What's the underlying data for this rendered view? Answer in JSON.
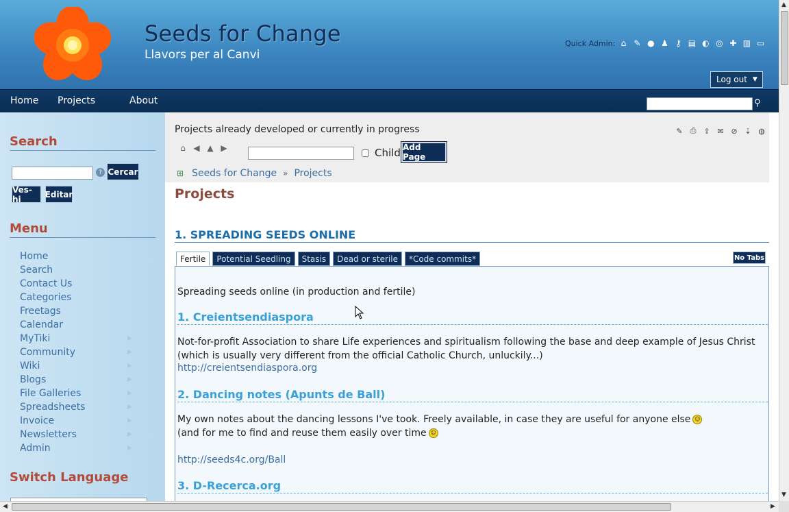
{
  "header": {
    "site_title": "Seeds for Change",
    "site_subtitle": "Llavors per al Canvi",
    "quick_admin_label": "Quick Admin:",
    "quick_admin_icons": [
      "home-icon",
      "wrench-icon",
      "user-icon",
      "users-icon",
      "key-icon",
      "modules-icon",
      "refresh-icon",
      "cache-icon",
      "plugin-icon",
      "list-icon",
      "window-icon"
    ],
    "logout_label": "Log out"
  },
  "nav": {
    "items": [
      "Home",
      "Projects",
      "About"
    ],
    "search_value": ""
  },
  "sidebar": {
    "search_heading": "Search",
    "search_value": "",
    "search_button": "Cercar",
    "goto_button": "Ves-hi",
    "edit_button": "Editar",
    "menu_heading": "Menu",
    "menu_items": [
      {
        "label": "Home",
        "sub": false
      },
      {
        "label": "Search",
        "sub": false
      },
      {
        "label": "Contact Us",
        "sub": false
      },
      {
        "label": "Categories",
        "sub": false
      },
      {
        "label": "Freetags",
        "sub": false
      },
      {
        "label": "Calendar",
        "sub": false
      },
      {
        "label": "MyTiki",
        "sub": true
      },
      {
        "label": "Community",
        "sub": true
      },
      {
        "label": "Wiki",
        "sub": true
      },
      {
        "label": "Blogs",
        "sub": true
      },
      {
        "label": "File Galleries",
        "sub": true
      },
      {
        "label": "Spreadsheets",
        "sub": true
      },
      {
        "label": "Invoice",
        "sub": true
      },
      {
        "label": "Newsletters",
        "sub": true
      },
      {
        "label": "Admin",
        "sub": true
      }
    ],
    "language_heading": "Switch Language"
  },
  "page": {
    "description": "Projects already developed or currently in progress",
    "child_label": "Child",
    "add_page_button": "Add Page",
    "breadcrumb": [
      "Seeds for Change",
      "Projects"
    ],
    "breadcrumb_sep": "»",
    "title": "Projects",
    "section_title": "1. SPREADING SEEDS ONLINE",
    "tabs": [
      "Fertile",
      "Potential Seedling",
      "Stasis",
      "Dead or sterile",
      "*Code commits*"
    ],
    "active_tab": "Fertile",
    "no_tabs_button": "No Tabs"
  },
  "content": {
    "intro": "Spreading seeds online (in production and fertile)",
    "projects": [
      {
        "heading": "1. Creientsendiaspora",
        "text": "Not-for-profit Association to share Life experiences and spiritualism following the base and deep example of Jesus Christ (which is usually very different from the official Catholic Church, unluckily...)",
        "link": "http://creientsendiaspora.org"
      },
      {
        "heading": "2. Dancing notes (Apunts de Ball)",
        "text": "My own notes about the dancing lessons I've took. Freely available, in case they are useful for anyone else",
        "text2": "(and for me to find and reuse them easily over time",
        "link": "http://seeds4c.org/Ball"
      },
      {
        "heading": "3. D-Recerca.org"
      }
    ]
  },
  "colors": {
    "header_blue": "#3c85c0",
    "nav_navy": "#0f3a66",
    "heading_red": "#b24a3a",
    "link_blue": "#3a6ea5"
  }
}
